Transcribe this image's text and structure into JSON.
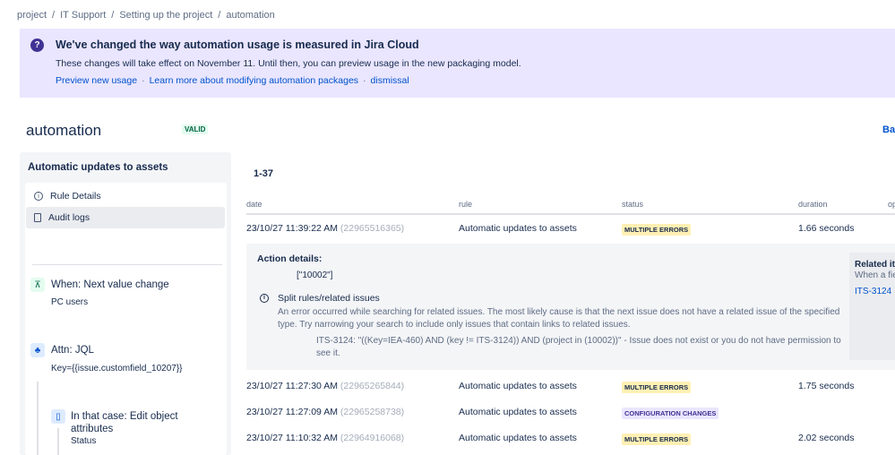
{
  "breadcrumb": [
    "project",
    "IT Support",
    "Setting up the project",
    "automation"
  ],
  "banner": {
    "title": "We've changed the way automation usage is measured in Jira Cloud",
    "description": "These changes will take effect on November 11. Until then, you can preview usage in the new packaging model.",
    "links": [
      "Preview new usage",
      "Learn more about modifying automation packages",
      "dismissal"
    ],
    "separator": "·"
  },
  "page": {
    "title": "automation",
    "badge": "VALID",
    "back_link": "Back"
  },
  "sidebar": {
    "title": "Automatic updates to assets",
    "nav": [
      {
        "label": "Rule Details",
        "icon": "info-icon"
      },
      {
        "label": "Audit logs",
        "icon": "document-icon"
      }
    ],
    "steps": [
      {
        "title": "When: Next value change",
        "subtitle": "PC users",
        "icon": "trigger-icon"
      },
      {
        "title": "Attn: JQL",
        "subtitle": "Key={{issue.customfield_10207}}",
        "icon": "branch-icon"
      },
      {
        "title": "In that case: Edit object attributes",
        "subtitle": "Status",
        "icon": "clipboard-icon"
      }
    ]
  },
  "log": {
    "range": "1-37",
    "columns": [
      "date",
      "rule",
      "status",
      "duration",
      "options"
    ],
    "rows": [
      {
        "date": "23/10/27 11:39:22 AM",
        "id": "(22965516365)",
        "rule": "Automatic updates to assets",
        "status": "MULTIPLE ERRORS",
        "status_type": "error",
        "duration": "1.66 seconds"
      },
      {
        "date": "23/10/27 11:27:30 AM",
        "id": "(22965265844)",
        "rule": "Automatic updates to assets",
        "status": "MULTIPLE ERRORS",
        "status_type": "error",
        "duration": "1.75 seconds"
      },
      {
        "date": "23/10/27 11:27:09 AM",
        "id": "(22965258738)",
        "rule": "Automatic updates to assets",
        "status": "CONFIGURATION CHANGES",
        "status_type": "config",
        "duration": ""
      },
      {
        "date": "23/10/27 11:10:32 AM",
        "id": "(22964916068)",
        "rule": "Automatic updates to assets",
        "status": "MULTIPLE ERRORS",
        "status_type": "error",
        "duration": "2.02 seconds"
      }
    ],
    "detail": {
      "heading": "Action details:",
      "value": "[\"10002\"]",
      "title": "Split rules/related issues",
      "message": "An error occurred while searching for related issues. The most likely cause is that the next issue does not have a related issue of the specified type. Try narrowing your search to include only issues that contain links to related issues.",
      "issue_message": "ITS-3124: \"((Key=IEA-460) AND (key != ITS-3124)) AND (project in (10002))\" - Issue does not exist or you do not have permission to see it.",
      "related_title": "Related items",
      "related_sub": "When a field",
      "related_link": "ITS-3124"
    }
  },
  "colors": {
    "accent": "#0052cc",
    "banner_bg": "#eae6ff",
    "error_bg": "#fff0b3",
    "config_bg": "#eae6ff",
    "valid_bg": "#e3fcef"
  }
}
